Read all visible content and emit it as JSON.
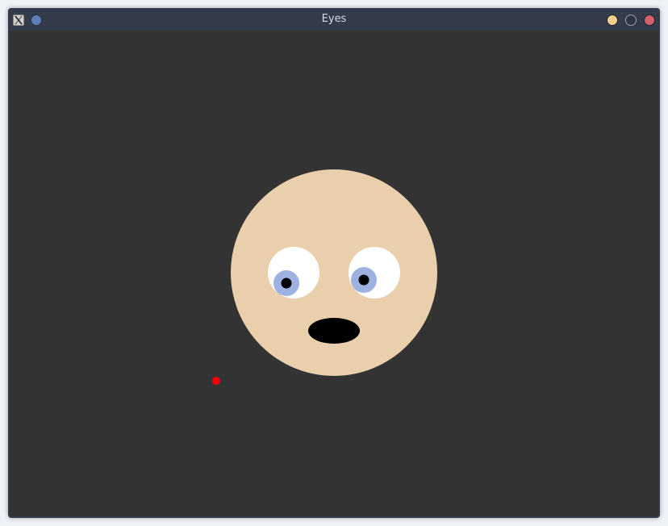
{
  "window": {
    "title": "Eyes",
    "controls": {
      "minimize_color": "#f2cf8e",
      "maximize_color": "#2e3443",
      "close_color": "#d4606b",
      "menu_color": "#5d80b7"
    }
  },
  "colors": {
    "background": "#333333",
    "face": "#e9cfab",
    "sclera": "#ffffff",
    "iris": "#9eb2e2",
    "pupil": "#000000",
    "mouth": "#000000",
    "pointer": "#ff0000"
  },
  "icons": {
    "app": "x-window-icon",
    "menu": "window-menu-icon",
    "minimize": "minimize-icon",
    "maximize": "maximize-icon",
    "close": "close-icon"
  }
}
